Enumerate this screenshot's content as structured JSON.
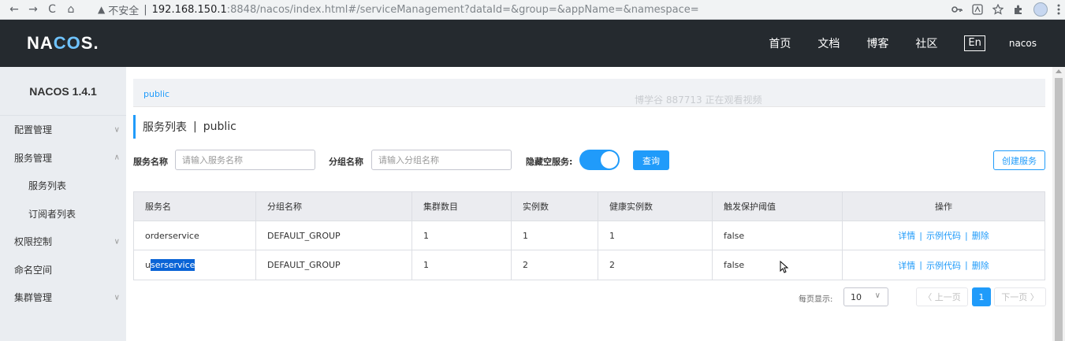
{
  "browser": {
    "back": "←",
    "forward": "→",
    "reload": "C",
    "home": "⌂",
    "warning": "▲",
    "insecure": "不安全",
    "divider": "|",
    "url_host": "192.168.150.1",
    "url_path": ":8848/nacos/index.html#/serviceManagement?dataId=&group=&appName=&namespace=",
    "right_icons": [
      "key-icon",
      "translate-icon",
      "star-icon",
      "extension-icon",
      "profile-icon",
      "menu-icon"
    ]
  },
  "topnav": {
    "logo_a": "NA",
    "logo_b": "CO",
    "logo_c": "S.",
    "items": [
      "首页",
      "文档",
      "博客",
      "社区"
    ],
    "lang": "En",
    "user": "nacos"
  },
  "sidebar": {
    "title": "NACOS 1.4.1",
    "items": [
      {
        "label": "配置管理",
        "chevron": "∨"
      },
      {
        "label": "服务管理",
        "chevron": "∧"
      },
      {
        "label": "服务列表",
        "chevron": ""
      },
      {
        "label": "订阅者列表",
        "chevron": ""
      },
      {
        "label": "权限控制",
        "chevron": "∨"
      },
      {
        "label": "命名空间",
        "chevron": ""
      },
      {
        "label": "集群管理",
        "chevron": "∨"
      }
    ]
  },
  "namespace": "public",
  "watermark": "博学谷 887713 正在观看视频",
  "page_title": {
    "main": "服务列表",
    "sep": "|",
    "ns": "public"
  },
  "filters": {
    "service_label": "服务名称",
    "service_placeholder": "请输入服务名称",
    "group_label": "分组名称",
    "group_placeholder": "请输入分组名称",
    "hide_empty_label": "隐藏空服务:",
    "hide_empty_on": true,
    "query_button": "查询",
    "create_button": "创建服务"
  },
  "table": {
    "headers": [
      "服务名",
      "分组名称",
      "集群数目",
      "实例数",
      "健康实例数",
      "触发保护阈值",
      "操作"
    ],
    "rows": [
      {
        "name_pre": "orderservice",
        "name_hl": "",
        "group": "DEFAULT_GROUP",
        "clusters": "1",
        "instances": "1",
        "healthy": "1",
        "threshold": "false"
      },
      {
        "name_pre": "u",
        "name_hl": "serservice",
        "group": "DEFAULT_GROUP",
        "clusters": "1",
        "instances": "2",
        "healthy": "2",
        "threshold": "false"
      }
    ],
    "ops": {
      "detail": "详情",
      "code": "示例代码",
      "delete": "删除",
      "sep": "|"
    }
  },
  "pagination": {
    "per_page_label": "每页显示:",
    "per_page": "10",
    "prev": "〈 上一页",
    "current": "1",
    "next": "下一页 〉"
  },
  "colors": {
    "accent": "#209bfa",
    "topbar": "#252a2f",
    "sidebar": "#eaedf1"
  }
}
